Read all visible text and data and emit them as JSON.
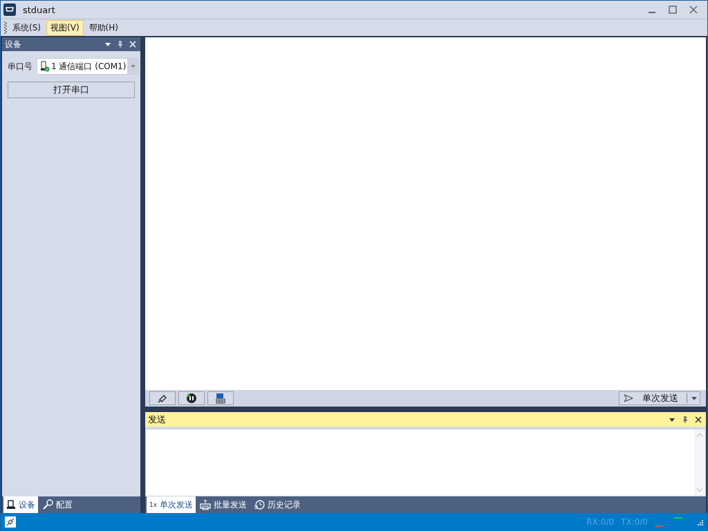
{
  "window": {
    "title": "stduart"
  },
  "menu": [
    {
      "label": "系统(S)",
      "selected": false
    },
    {
      "label": "视图(V)",
      "selected": true
    },
    {
      "label": "帮助(H)",
      "selected": false
    }
  ],
  "device_panel": {
    "title": "设备",
    "port_label": "串口号",
    "port_value": "1 通信端口 (COM1)",
    "open_button": "打开串口"
  },
  "left_tabs": [
    {
      "label": "设备",
      "kind": "device",
      "selected": true
    },
    {
      "label": "配置",
      "kind": "config",
      "selected": false
    }
  ],
  "output_toolbar": {
    "send_button": "单次发送"
  },
  "send_panel": {
    "title": "发送"
  },
  "bottom_tabs": [
    {
      "label": "单次发送",
      "kind": "single",
      "prefix": "1x",
      "selected": true
    },
    {
      "label": "批量发送",
      "kind": "batch",
      "selected": false
    },
    {
      "label": "历史记录",
      "kind": "history",
      "selected": false
    }
  ],
  "status_bar": {
    "rx": "RX:0/0",
    "tx": "TX:0/0"
  }
}
